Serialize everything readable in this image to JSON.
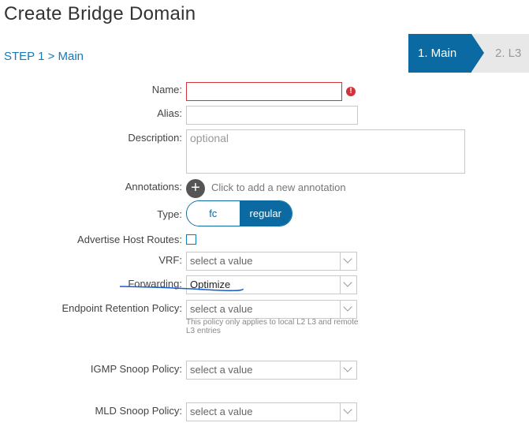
{
  "header": {
    "title": "Create Bridge Domain",
    "breadcrumb": "STEP 1 > Main"
  },
  "wizard": {
    "steps": [
      {
        "label": "1. Main",
        "active": true
      },
      {
        "label": "2. L3",
        "active": false
      }
    ],
    "accent_color": "#0a6aa1"
  },
  "form": {
    "name": {
      "label": "Name:",
      "value": "",
      "error": true
    },
    "alias": {
      "label": "Alias:",
      "value": ""
    },
    "description": {
      "label": "Description:",
      "placeholder": "optional"
    },
    "annotations": {
      "label": "Annotations:",
      "add_text": "Click to add a new annotation"
    },
    "type": {
      "label": "Type:",
      "options": [
        "fc",
        "regular"
      ],
      "selected": "regular"
    },
    "advertise_host_routes": {
      "label": "Advertise Host Routes:",
      "checked": false
    },
    "vrf": {
      "label": "VRF:",
      "value": "select a value"
    },
    "forwarding": {
      "label": "Forwarding:",
      "value": "Optimize"
    },
    "endpoint_retention_policy": {
      "label": "Endpoint Retention Policy:",
      "value": "select a value",
      "hint": "This policy only applies to local L2 L3 and remote L3 entries"
    },
    "igmp_snoop_policy": {
      "label": "IGMP Snoop Policy:",
      "value": "select a value"
    },
    "mld_snoop_policy": {
      "label": "MLD Snoop Policy:",
      "value": "select a value"
    }
  },
  "colors": {
    "error": "#d0343d",
    "link": "#1479b8"
  }
}
